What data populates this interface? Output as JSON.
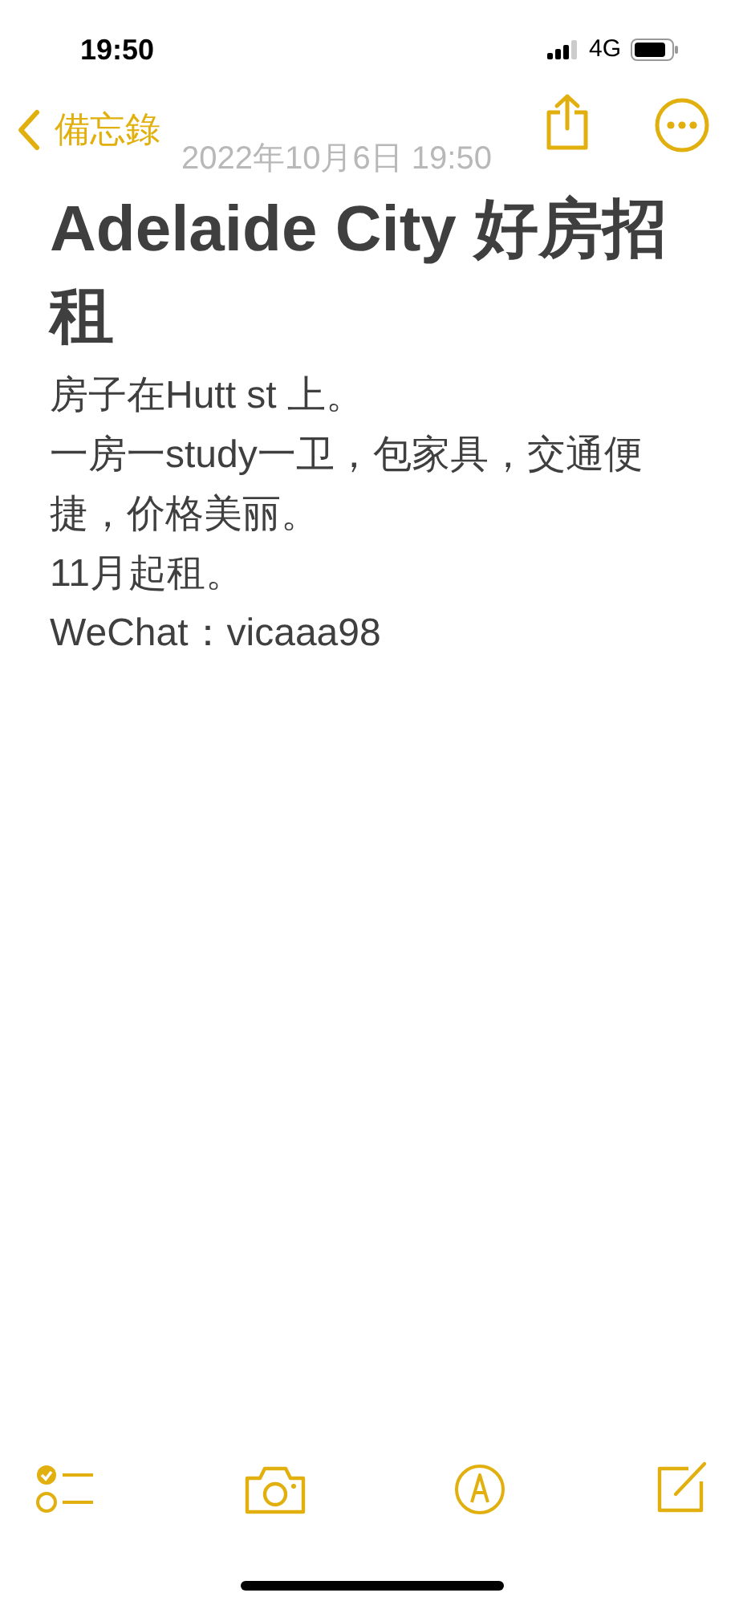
{
  "status_bar": {
    "time": "19:50",
    "network": "4G"
  },
  "nav": {
    "back_label": "備忘錄",
    "date": "2022年10月6日 19:50"
  },
  "note": {
    "title": "Adelaide City 好房招租",
    "lines": [
      "房子在Hutt st 上。",
      "一房一study一卫，包家具，交通便捷，价格美丽。",
      "11月起租。",
      "WeChat：vicaaa98"
    ]
  }
}
